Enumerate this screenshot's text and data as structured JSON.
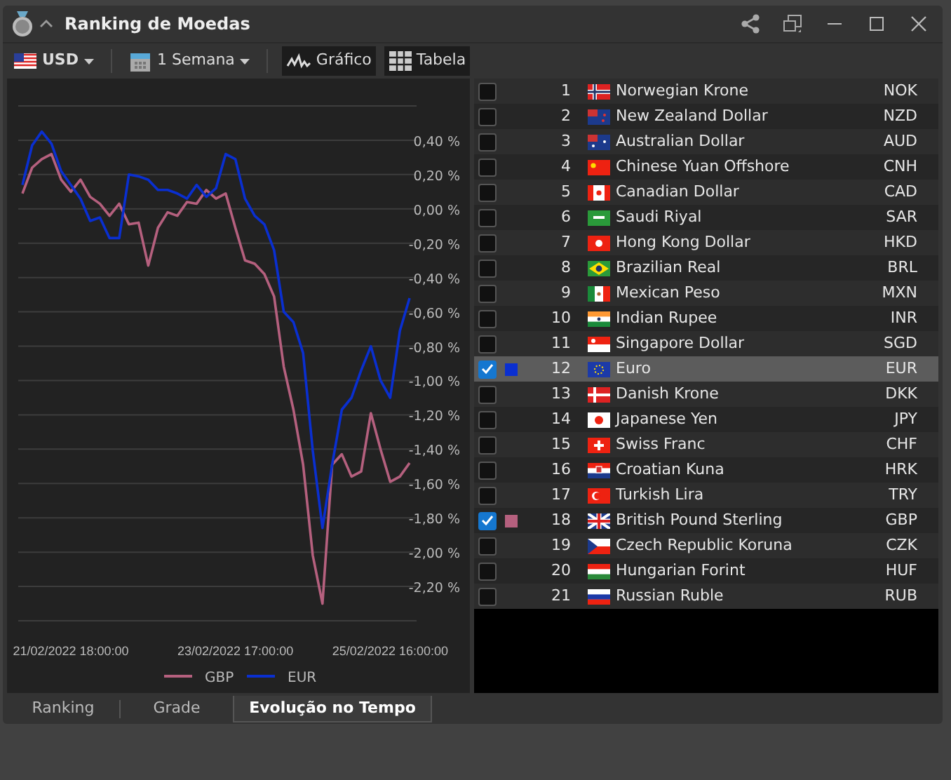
{
  "window": {
    "title": "Ranking de Moedas"
  },
  "toolbar": {
    "currency": "USD",
    "period": "1 Semana",
    "views": [
      {
        "label": "Gráfico"
      },
      {
        "label": "Tabela"
      }
    ]
  },
  "chart": {
    "chart_data": {
      "type": "line",
      "categories": [
        null,
        null,
        null,
        null,
        null,
        "21/02/2022 18:00:00",
        null,
        null,
        null,
        null,
        null,
        null,
        null,
        null,
        null,
        null,
        null,
        null,
        null,
        null,
        null,
        null,
        "23/02/2022 17:00:00",
        null,
        null,
        null,
        null,
        null,
        null,
        null,
        null,
        null,
        null,
        null,
        null,
        null,
        null,
        null,
        "25/02/2022 16:00:00",
        null,
        null
      ],
      "yticks": [
        {
          "value": 0.4,
          "label": "0,40 %"
        },
        {
          "value": 0.2,
          "label": "0,20 %"
        },
        {
          "value": 0,
          "label": "0,00 %"
        },
        {
          "value": -0.2,
          "label": "-0,20 %"
        },
        {
          "value": -0.4,
          "label": "-0,40 %"
        },
        {
          "value": -0.6,
          "label": "-0,60 %"
        },
        {
          "value": -0.8,
          "label": "-0,80 %"
        },
        {
          "value": -1,
          "label": "-1,00 %"
        },
        {
          "value": -1.2,
          "label": "-1,20 %"
        },
        {
          "value": -1.4,
          "label": "-1,40 %"
        },
        {
          "value": -1.6,
          "label": "-1,60 %"
        },
        {
          "value": -1.8,
          "label": "-1,80 %"
        },
        {
          "value": -2,
          "label": "-2,00 %"
        },
        {
          "value": -2.2,
          "label": "-2,20 %"
        }
      ],
      "ylim": [
        -2.4,
        0.6
      ],
      "grid": true,
      "legend": "bottom",
      "series": [
        {
          "name": "GBP",
          "color": "#b5607e",
          "values": [
            0.09,
            0.24,
            0.29,
            0.32,
            0.17,
            0.1,
            0.17,
            0.07,
            0.03,
            -0.04,
            0.03,
            -0.09,
            -0.08,
            -0.33,
            -0.11,
            -0.02,
            -0.04,
            0.04,
            0.03,
            0.11,
            0.06,
            0.09,
            -0.11,
            -0.3,
            -0.32,
            -0.38,
            -0.51,
            -0.92,
            -1.17,
            -1.49,
            -2.02,
            -2.3,
            -1.49,
            -1.43,
            -1.56,
            -1.53,
            -1.19,
            -1.4,
            -1.59,
            -1.56,
            -1.48
          ]
        },
        {
          "name": "EUR",
          "color": "#0a2fd0",
          "values": [
            0.14,
            0.37,
            0.45,
            0.38,
            0.22,
            0.14,
            0.06,
            -0.07,
            -0.05,
            -0.17,
            -0.17,
            0.2,
            0.19,
            0.17,
            0.11,
            0.11,
            0.09,
            0.06,
            0.14,
            0.07,
            0.12,
            0.32,
            0.29,
            0.06,
            -0.04,
            -0.09,
            -0.24,
            -0.6,
            -0.66,
            -0.84,
            -1.41,
            -1.86,
            -1.49,
            -1.17,
            -1.1,
            -0.94,
            -0.8,
            -1.0,
            -1.1,
            -0.71,
            -0.52
          ]
        }
      ]
    }
  },
  "table": {
    "rows": [
      {
        "rank": "1",
        "name": "Norwegian Krone",
        "code": "NOK",
        "checked": false,
        "selected": false
      },
      {
        "rank": "2",
        "name": "New Zealand Dollar",
        "code": "NZD",
        "checked": false,
        "selected": false
      },
      {
        "rank": "3",
        "name": "Australian Dollar",
        "code": "AUD",
        "checked": false,
        "selected": false
      },
      {
        "rank": "4",
        "name": "Chinese Yuan Offshore",
        "code": "CNH",
        "checked": false,
        "selected": false
      },
      {
        "rank": "5",
        "name": "Canadian Dollar",
        "code": "CAD",
        "checked": false,
        "selected": false
      },
      {
        "rank": "6",
        "name": "Saudi Riyal",
        "code": "SAR",
        "checked": false,
        "selected": false
      },
      {
        "rank": "7",
        "name": "Hong Kong Dollar",
        "code": "HKD",
        "checked": false,
        "selected": false
      },
      {
        "rank": "8",
        "name": "Brazilian Real",
        "code": "BRL",
        "checked": false,
        "selected": false
      },
      {
        "rank": "9",
        "name": "Mexican Peso",
        "code": "MXN",
        "checked": false,
        "selected": false
      },
      {
        "rank": "10",
        "name": "Indian Rupee",
        "code": "INR",
        "checked": false,
        "selected": false
      },
      {
        "rank": "11",
        "name": "Singapore Dollar",
        "code": "SGD",
        "checked": false,
        "selected": false
      },
      {
        "rank": "12",
        "name": "Euro",
        "code": "EUR",
        "checked": true,
        "selected": true,
        "color": "#0a2fd0"
      },
      {
        "rank": "13",
        "name": "Danish Krone",
        "code": "DKK",
        "checked": false,
        "selected": false
      },
      {
        "rank": "14",
        "name": "Japanese Yen",
        "code": "JPY",
        "checked": false,
        "selected": false
      },
      {
        "rank": "15",
        "name": "Swiss Franc",
        "code": "CHF",
        "checked": false,
        "selected": false
      },
      {
        "rank": "16",
        "name": "Croatian Kuna",
        "code": "HRK",
        "checked": false,
        "selected": false
      },
      {
        "rank": "17",
        "name": "Turkish Lira",
        "code": "TRY",
        "checked": false,
        "selected": false
      },
      {
        "rank": "18",
        "name": "British Pound Sterling",
        "code": "GBP",
        "checked": true,
        "selected": false,
        "color": "#b5607e"
      },
      {
        "rank": "19",
        "name": "Czech Republic Koruna",
        "code": "CZK",
        "checked": false,
        "selected": false
      },
      {
        "rank": "20",
        "name": "Hungarian Forint",
        "code": "HUF",
        "checked": false,
        "selected": false
      },
      {
        "rank": "21",
        "name": "Russian Ruble",
        "code": "RUB",
        "checked": false,
        "selected": false
      }
    ]
  },
  "bottom_tabs": [
    {
      "label": "Ranking",
      "selected": false
    },
    {
      "label": "Grade",
      "selected": false
    },
    {
      "label": "Evolução no Tempo",
      "selected": true
    }
  ]
}
